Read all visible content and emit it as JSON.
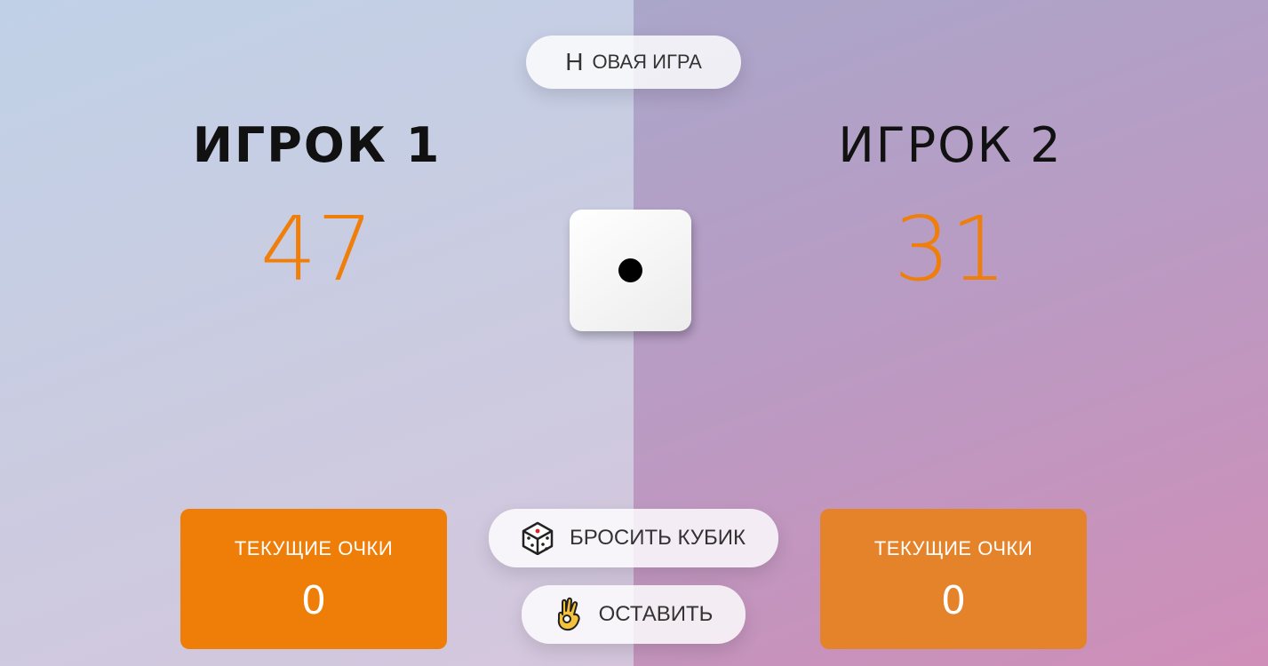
{
  "header": {
    "new_game_first": "Н",
    "new_game_rest": "ОВАЯ ИГРА"
  },
  "players": [
    {
      "name": "ИГРОК 1",
      "score": "47",
      "current_label": "ТЕКУЩИЕ ОЧКИ",
      "current_value": "0"
    },
    {
      "name": "ИГРОК 2",
      "score": "31",
      "current_label": "ТЕКУЩИЕ ОЧКИ",
      "current_value": "0"
    }
  ],
  "dice": {
    "value": 1
  },
  "controls": {
    "roll_label": "БРОСИТЬ КУБИК",
    "roll_icon": "dice-icon",
    "hold_label": "ОСТАВИТЬ",
    "hold_icon": "ok-hand-icon"
  },
  "colors": {
    "accent": "#ef7e0a",
    "active_current_bg": "#ee7e08",
    "inactive_current_bg": "#e5832a"
  }
}
